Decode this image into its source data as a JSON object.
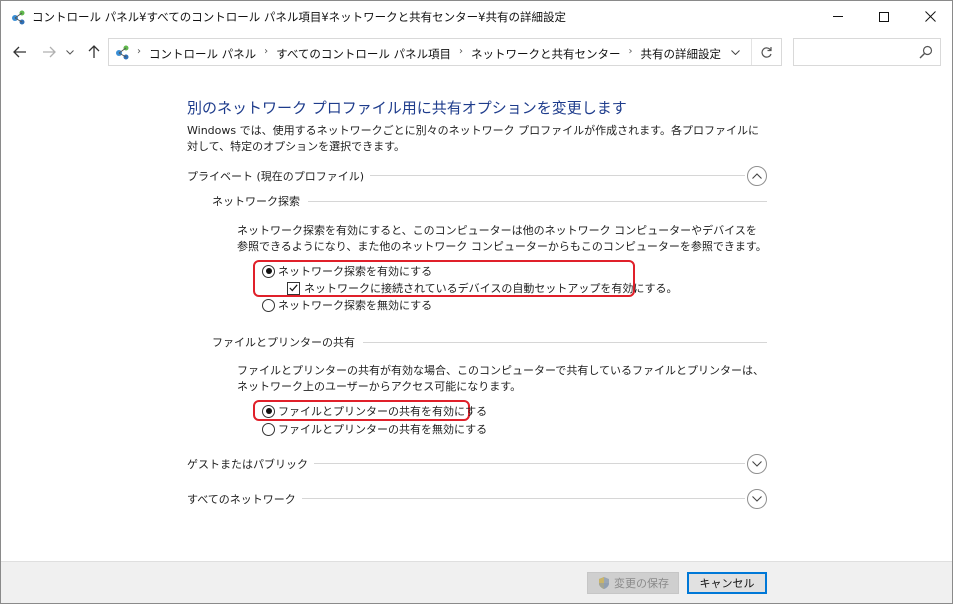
{
  "window": {
    "title": "コントロール パネル¥すべてのコントロール パネル項目¥ネットワークと共有センター¥共有の詳細設定"
  },
  "addressbar": {
    "breadcrumbs": [
      "コントロール パネル",
      "すべてのコントロール パネル項目",
      "ネットワークと共有センター",
      "共有の詳細設定"
    ],
    "search_placeholder": ""
  },
  "content": {
    "heading": "別のネットワーク プロファイル用に共有オプションを変更します",
    "intro": "Windows では、使用するネットワークごとに別々のネットワーク プロファイルが作成されます。各プロファイルに対して、特定のオプションを選択できます。",
    "private_profile": {
      "label": "プライベート (現在のプロファイル)",
      "network_discovery": {
        "label": "ネットワーク探索",
        "description": "ネットワーク探索を有効にすると、このコンピューターは他のネットワーク コンピューターやデバイスを参照できるようになり、また他のネットワーク コンピューターからもこのコンピューターを参照できます。",
        "option_on": "ネットワーク探索を有効にする",
        "option_auto_setup": "ネットワークに接続されているデバイスの自動セットアップを有効にする。",
        "option_off": "ネットワーク探索を無効にする",
        "selected": "on",
        "auto_setup_checked": true
      },
      "file_printer_sharing": {
        "label": "ファイルとプリンターの共有",
        "description": "ファイルとプリンターの共有が有効な場合、このコンピューターで共有しているファイルとプリンターは、ネットワーク上のユーザーからアクセス可能になります。",
        "option_on": "ファイルとプリンターの共有を有効にする",
        "option_off": "ファイルとプリンターの共有を無効にする",
        "selected": "on"
      }
    },
    "guest_public_profile": {
      "label": "ゲストまたはパブリック"
    },
    "all_networks_profile": {
      "label": "すべてのネットワーク"
    }
  },
  "footer": {
    "save_label": "変更の保存",
    "cancel_label": "キャンセル"
  },
  "colors": {
    "heading": "#1e3c8c",
    "highlight": "#e0202a",
    "focus": "#0078d7"
  },
  "icons": {
    "title": "network-center-icon",
    "save": "uac-shield-icon"
  }
}
